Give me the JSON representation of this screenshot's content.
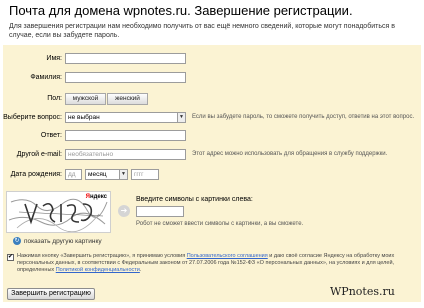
{
  "title": "Почта для домена wpnotes.ru. Завершение регистрации.",
  "intro": "Для завершения регистрации нам необходимо получить от вас ещё немного сведений, которые могут понадобиться в случае, если вы забудете пароль.",
  "form": {
    "name_label": "Имя:",
    "surname_label": "Фамилия:",
    "gender_label": "Пол:",
    "gender_male": "мужской",
    "gender_female": "женский",
    "question_label": "Выберите вопрос:",
    "question_value": "не выбран",
    "question_hint": "Если вы забудете пароль, то сможете получить доступ, ответив на этот вопрос.",
    "answer_label": "Ответ:",
    "email_label": "Другой e-mail:",
    "email_placeholder": "необязательно",
    "email_hint": "Этот адрес можно использовать для обращения в службу поддержки.",
    "birth_label": "Дата рождения:",
    "birth_day_placeholder": "дд",
    "birth_month_value": "месяц",
    "birth_year_placeholder": "гггг"
  },
  "captcha": {
    "logo_first": "Я",
    "logo_rest": "ндекс",
    "label": "Введите символы с картинки слева:",
    "hint": "Робот не сможет ввести символы с картинки, а вы сможете.",
    "refresh_label": "показать другую картинку"
  },
  "agreement": {
    "text_1": "Нажимая кнопку «Завершить регистрацию», я принимаю условия ",
    "link_1": "Пользовательского соглашения",
    "text_2": " и даю своё согласие Яндексу на обработку моих персональных данных, в соответствии с Федеральным законом от 27.07.2006 года №152-ФЗ «О персональных данных», на условиях и для целей, определенных ",
    "link_2": "Политикой конфиденциальности",
    "text_3": "."
  },
  "submit_label": "Завершить регистрацию",
  "watermark": "WPnotes.ru",
  "icons": {
    "arrow": "arrow-right-icon",
    "refresh": "refresh-icon",
    "dropdown": "chevron-down-icon"
  }
}
